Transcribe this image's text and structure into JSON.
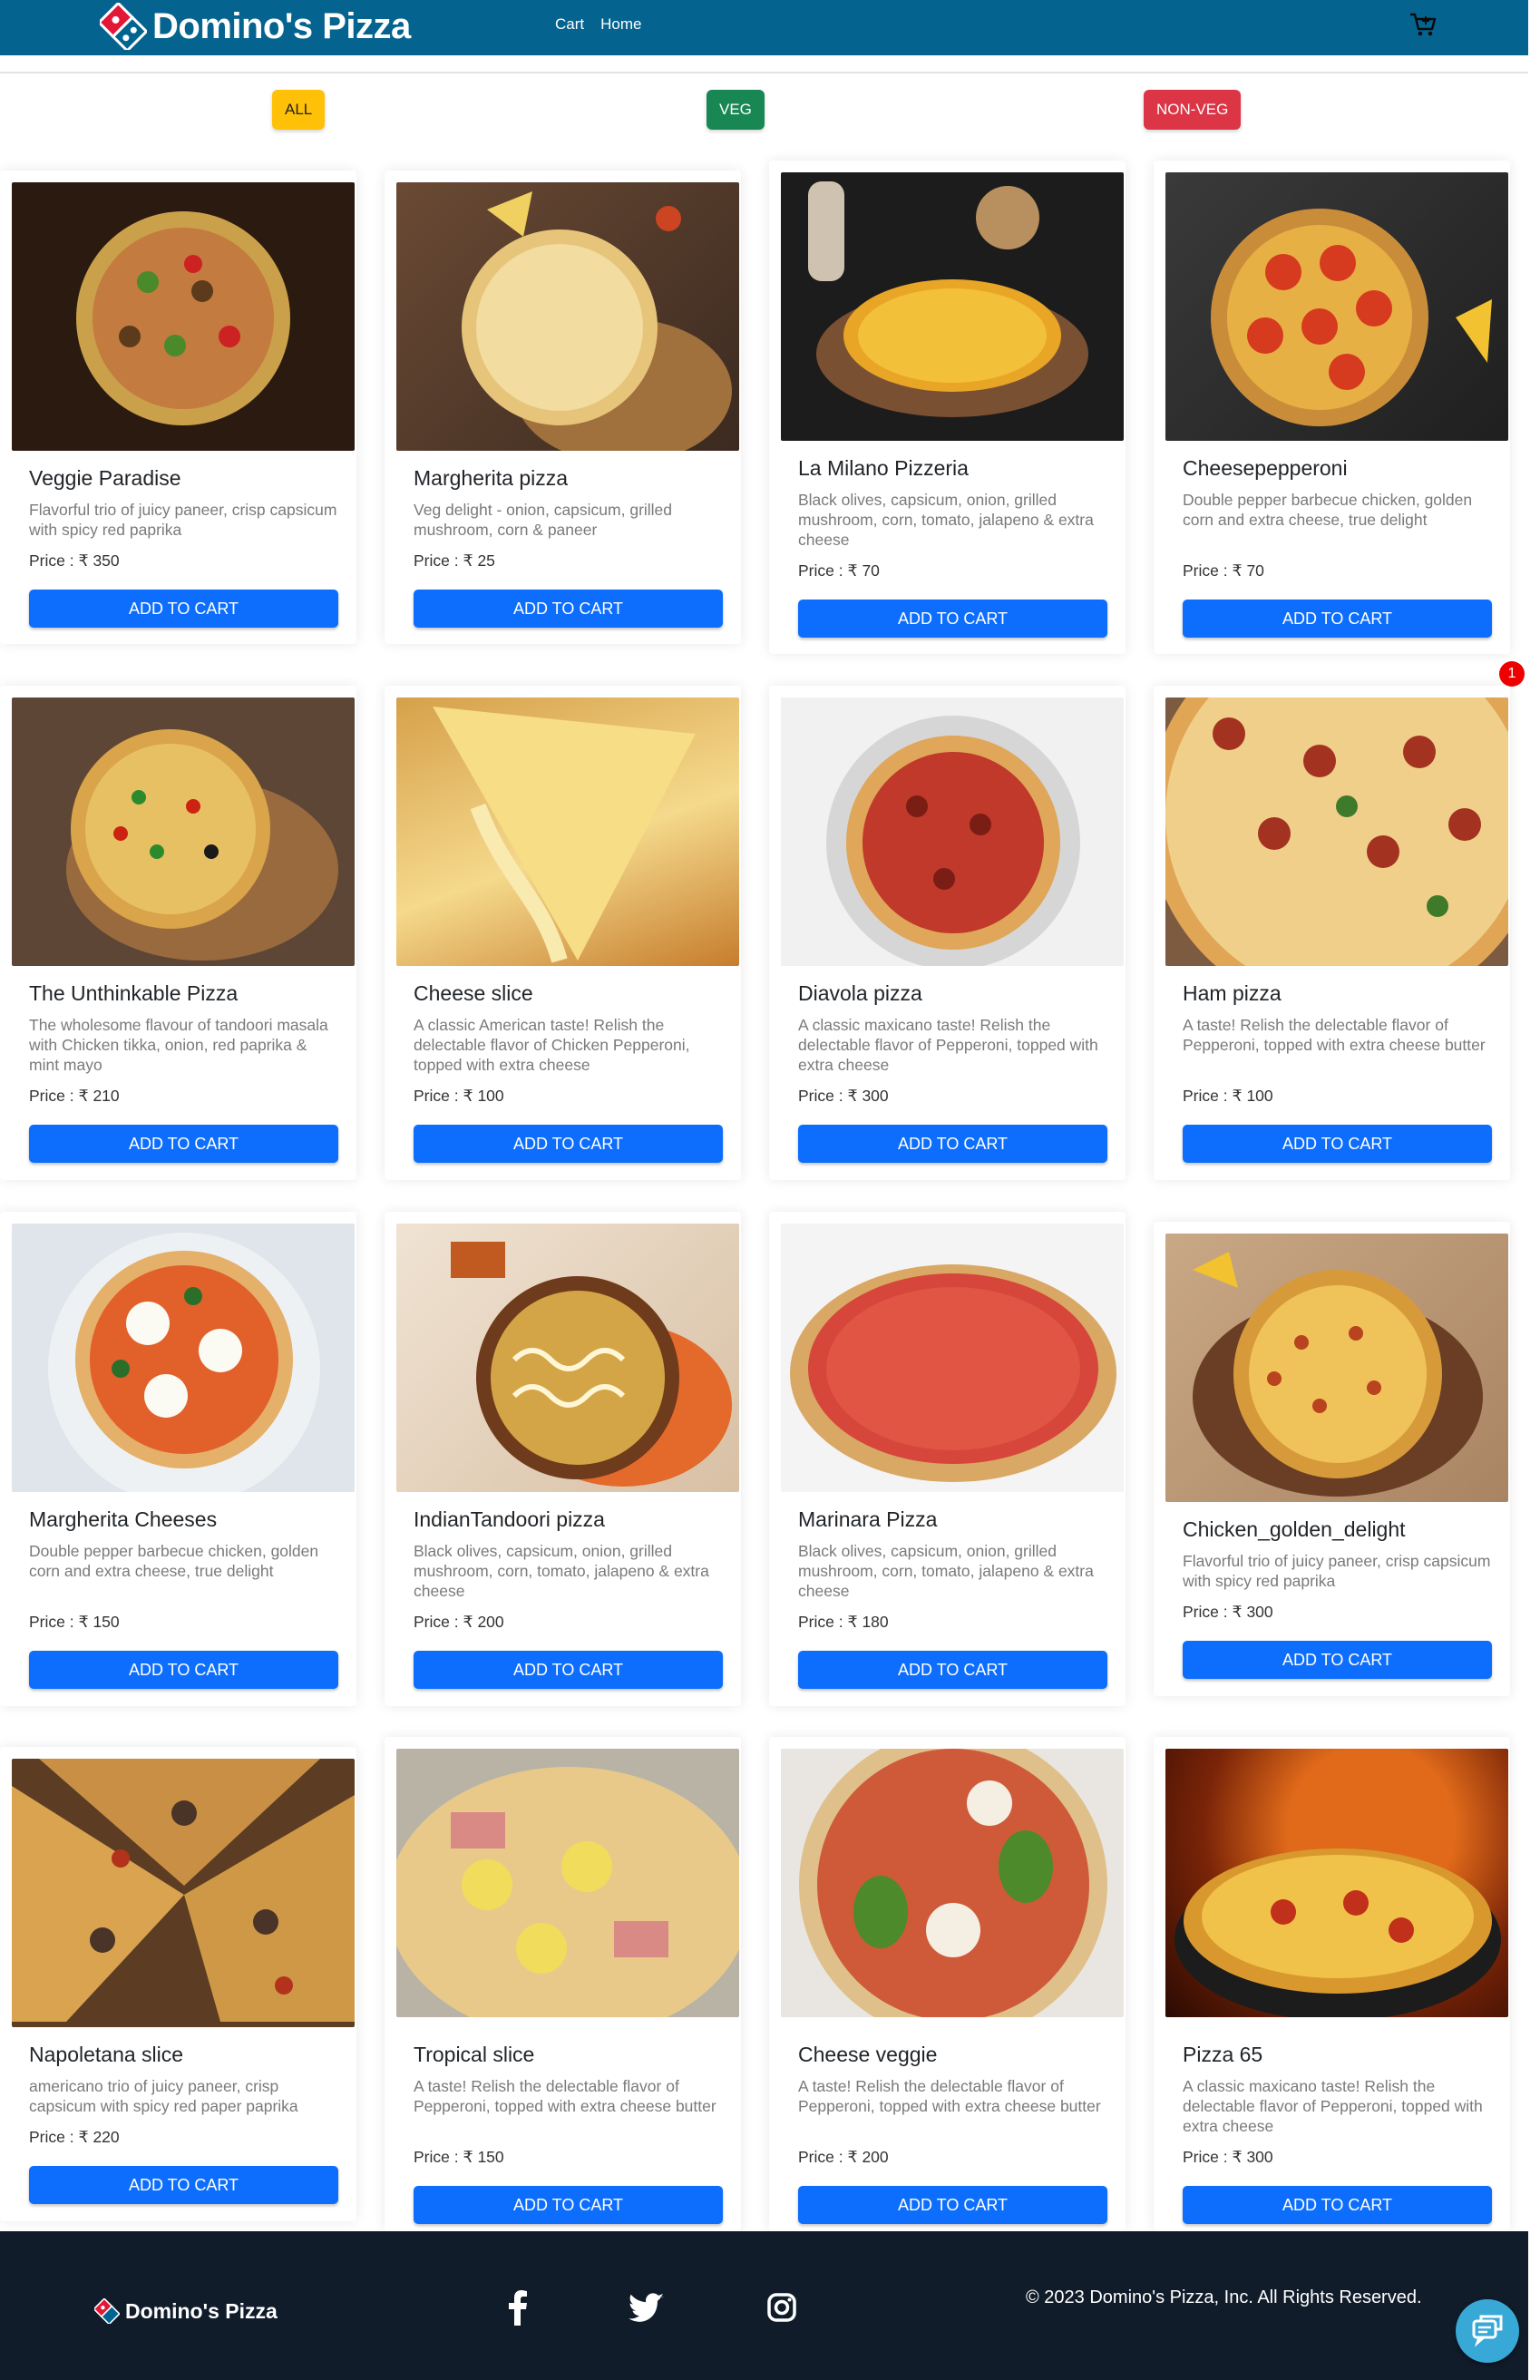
{
  "header": {
    "brand": "Domino's Pizza",
    "nav": [
      "Cart",
      "Home"
    ],
    "cart_icon": "cart-icon"
  },
  "filters": [
    "ALL",
    "VEG",
    "NON-VEG"
  ],
  "cart_badge": "1",
  "products": [
    {
      "name": "Veggie Paradise",
      "desc": "Flavorful trio of juicy paneer, crisp capsicum with spicy red paprika",
      "price": "Price : ₹ 350",
      "button": "ADD TO CART"
    },
    {
      "name": "Margherita pizza",
      "desc": "Veg delight - onion, capsicum, grilled mushroom, corn & paneer",
      "price": "Price : ₹ 25",
      "button": "ADD TO CART"
    },
    {
      "name": "La Milano Pizzeria",
      "desc": "Black olives, capsicum, onion, grilled mushroom, corn, tomato, jalapeno & extra cheese",
      "price": "Price : ₹ 70",
      "button": "ADD TO CART"
    },
    {
      "name": "Cheesepepperoni",
      "desc": "Double pepper barbecue chicken, golden corn and extra cheese, true delight",
      "price": "Price : ₹ 70",
      "button": "ADD TO CART"
    },
    {
      "name": "The Unthinkable Pizza",
      "desc": "The wholesome flavour of tandoori masala with Chicken tikka, onion, red paprika & mint mayo",
      "price": "Price : ₹ 210",
      "button": "ADD TO CART"
    },
    {
      "name": "Cheese slice",
      "desc": "A classic American taste! Relish the delectable flavor of Chicken Pepperoni, topped with extra cheese",
      "price": "Price : ₹ 100",
      "button": "ADD TO CART"
    },
    {
      "name": "Diavola pizza",
      "desc": "A classic maxicano taste! Relish the delectable flavor of Pepperoni, topped with extra cheese",
      "price": "Price : ₹ 300",
      "button": "ADD TO CART"
    },
    {
      "name": "Ham pizza",
      "desc": "A taste! Relish the delectable flavor of Pepperoni, topped with extra cheese butter",
      "price": "Price : ₹ 100",
      "button": "ADD TO CART"
    },
    {
      "name": "Margherita Cheeses",
      "desc": "Double pepper barbecue chicken, golden corn and extra cheese, true delight",
      "price": "Price : ₹ 150",
      "button": "ADD TO CART"
    },
    {
      "name": "IndianTandoori pizza",
      "desc": "Black olives, capsicum, onion, grilled mushroom, corn, tomato, jalapeno & extra cheese",
      "price": "Price : ₹ 200",
      "button": "ADD TO CART"
    },
    {
      "name": "Marinara Pizza",
      "desc": "Black olives, capsicum, onion, grilled mushroom, corn, tomato, jalapeno & extra cheese",
      "price": "Price : ₹ 180",
      "button": "ADD TO CART"
    },
    {
      "name": "Chicken_golden_delight",
      "desc": "Flavorful trio of juicy paneer, crisp capsicum with spicy red paprika",
      "price": "Price : ₹ 300",
      "button": "ADD TO CART"
    },
    {
      "name": "Napoletana slice",
      "desc": "americano trio of juicy paneer, crisp capsicum with spicy red paper paprika",
      "price": "Price : ₹ 220",
      "button": "ADD TO CART"
    },
    {
      "name": "Tropical slice",
      "desc": "A taste! Relish the delectable flavor of Pepperoni, topped with extra cheese butter",
      "price": "Price : ₹ 150",
      "button": "ADD TO CART"
    },
    {
      "name": "Cheese veggie",
      "desc": "A taste! Relish the delectable flavor of Pepperoni, topped with extra cheese butter",
      "price": "Price : ₹ 200",
      "button": "ADD TO CART"
    },
    {
      "name": "Pizza 65",
      "desc": "A classic maxicano taste! Relish the delectable flavor of Pepperoni, topped with extra cheese",
      "price": "Price : ₹ 300",
      "button": "ADD TO CART"
    }
  ],
  "footer": {
    "brand": "Domino's Pizza",
    "social": [
      "facebook-icon",
      "twitter-icon",
      "instagram-icon"
    ],
    "copyright": "© 2023 Domino's Pizza, Inc. All Rights Reserved.",
    "chat_icon": "chat-support-icon"
  },
  "colors": {
    "navbar": "#05638f",
    "primary_button": "#0d6efd",
    "filter_all": "#ffc107",
    "filter_veg": "#198754",
    "filter_nonveg": "#dc3545",
    "footer": "#111c2b"
  }
}
